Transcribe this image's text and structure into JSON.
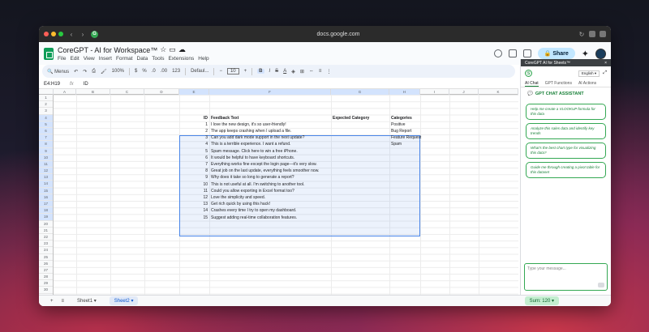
{
  "browser": {
    "url": "docs.google.com"
  },
  "app": {
    "title": "CoreGPT - AI for Workspace™",
    "menus": [
      "File",
      "Edit",
      "View",
      "Insert",
      "Format",
      "Data",
      "Tools",
      "Extensions",
      "Help"
    ],
    "share_label": "Share"
  },
  "toolbar": {
    "menus_label": "Menus",
    "zoom": "100%",
    "format_currency": "$",
    "format_percent": "%",
    "decimal_decrease": ".0",
    "decimal_increase": ".00",
    "format_number": "123",
    "font": "Defaul...",
    "font_size": "10",
    "bold": "B",
    "italic": "I",
    "strike": "S",
    "text_color": "A"
  },
  "formula": {
    "cell_ref": "E4:H19",
    "fx": "fx",
    "value": "ID"
  },
  "columns": [
    "A",
    "B",
    "C",
    "D",
    "E",
    "F",
    "G",
    "H",
    "I",
    "J",
    "K"
  ],
  "rows": [
    "1",
    "2",
    "3",
    "4",
    "5",
    "6",
    "7",
    "8",
    "9",
    "10",
    "11",
    "12",
    "13",
    "14",
    "15",
    "16",
    "17",
    "18",
    "19",
    "20",
    "21",
    "22",
    "23",
    "24",
    "25",
    "26",
    "27",
    "28",
    "29",
    "30",
    "31"
  ],
  "table": {
    "headers": {
      "id": "ID",
      "feedback": "Feedback Text",
      "expected": "Expected Category",
      "categories": "Categories"
    },
    "entries": [
      {
        "id": "1",
        "text": "I love the new design, it's so user-friendly!",
        "cat": "Positive"
      },
      {
        "id": "2",
        "text": "The app keeps crashing when I upload a file.",
        "cat": "Bug Report"
      },
      {
        "id": "3",
        "text": "Can you add dark mode support in the next update?",
        "cat": "Feature Request"
      },
      {
        "id": "4",
        "text": "This is a terrible experience. I want a refund.",
        "cat": "Spam"
      },
      {
        "id": "5",
        "text": "Spam message. Click here to win a free iPhone.",
        "cat": ""
      },
      {
        "id": "6",
        "text": "It would be helpful to have keyboard shortcuts.",
        "cat": ""
      },
      {
        "id": "7",
        "text": "Everything works fine except the login page—it's very slow.",
        "cat": ""
      },
      {
        "id": "8",
        "text": "Great job on the last update, everything feels smoother now.",
        "cat": ""
      },
      {
        "id": "9",
        "text": "Why does it take so long to generate a report?",
        "cat": ""
      },
      {
        "id": "10",
        "text": "This is not useful at all. I'm switching to another tool.",
        "cat": ""
      },
      {
        "id": "11",
        "text": "Could you allow exporting in Excel format too?",
        "cat": ""
      },
      {
        "id": "12",
        "text": "Love the simplicity and speed.",
        "cat": ""
      },
      {
        "id": "13",
        "text": "Get rich quick by using this hack!",
        "cat": ""
      },
      {
        "id": "14",
        "text": "Crashes every time I try to open my dashboard.",
        "cat": ""
      },
      {
        "id": "15",
        "text": "Suggest adding real-time collaboration features.",
        "cat": ""
      }
    ]
  },
  "sheets": {
    "tabs": [
      "Sheet1",
      "Sheet2"
    ],
    "sum": "Sum: 120"
  },
  "sidebar": {
    "title": "CoreGPT AI for Sheets™",
    "close": "×",
    "badge": "S",
    "language": "English",
    "tabs": [
      "AI Chat",
      "GPT Functions",
      "AI Actions"
    ],
    "assistant_title": "GPT CHAT ASSISTANT",
    "suggestions": [
      "Help me create a VLOOKUP formula for this data",
      "Analyze this sales data and identify key trends",
      "What's the best chart type for visualizing this data?",
      "Guide me through creating a pivot table for this dataset"
    ],
    "chat_placeholder": "Type your message..."
  },
  "colors": {
    "accent": "#188038",
    "share": "#c2e7ff",
    "selection": "#4a86e8"
  }
}
